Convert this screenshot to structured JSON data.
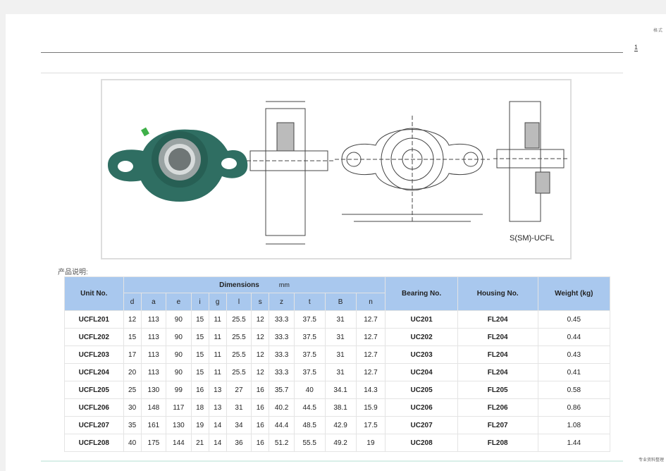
{
  "header": {
    "top_note": "格式",
    "page_number": "1"
  },
  "figure": {
    "label": "S(SM)-UCFL"
  },
  "caption": "产品说明:",
  "table": {
    "col_unit": "Unit No.",
    "dims_title": "Dimensions",
    "dims_unit": "mm",
    "col_bearing": "Bearing No.",
    "col_housing": "Housing No.",
    "col_weight": "Weight (kg)",
    "dim_cols": [
      "d",
      "a",
      "e",
      "i",
      "g",
      "l",
      "s",
      "z",
      "t",
      "B",
      "n"
    ],
    "rows": [
      {
        "unit": "UCFL201",
        "dims": [
          "12",
          "113",
          "90",
          "15",
          "11",
          "25.5",
          "12",
          "33.3",
          "37.5",
          "31",
          "12.7"
        ],
        "bearing": "UC201",
        "housing": "FL204",
        "weight": "0.45"
      },
      {
        "unit": "UCFL202",
        "dims": [
          "15",
          "113",
          "90",
          "15",
          "11",
          "25.5",
          "12",
          "33.3",
          "37.5",
          "31",
          "12.7"
        ],
        "bearing": "UC202",
        "housing": "FL204",
        "weight": "0.44"
      },
      {
        "unit": "UCFL203",
        "dims": [
          "17",
          "113",
          "90",
          "15",
          "11",
          "25.5",
          "12",
          "33.3",
          "37.5",
          "31",
          "12.7"
        ],
        "bearing": "UC203",
        "housing": "FL204",
        "weight": "0.43"
      },
      {
        "unit": "UCFL204",
        "dims": [
          "20",
          "113",
          "90",
          "15",
          "11",
          "25.5",
          "12",
          "33.3",
          "37.5",
          "31",
          "12.7"
        ],
        "bearing": "UC204",
        "housing": "FL204",
        "weight": "0.41"
      },
      {
        "unit": "UCFL205",
        "dims": [
          "25",
          "130",
          "99",
          "16",
          "13",
          "27",
          "16",
          "35.7",
          "40",
          "34.1",
          "14.3"
        ],
        "bearing": "UC205",
        "housing": "FL205",
        "weight": "0.58"
      },
      {
        "unit": "UCFL206",
        "dims": [
          "30",
          "148",
          "117",
          "18",
          "13",
          "31",
          "16",
          "40.2",
          "44.5",
          "38.1",
          "15.9"
        ],
        "bearing": "UC206",
        "housing": "FL206",
        "weight": "0.86"
      },
      {
        "unit": "UCFL207",
        "dims": [
          "35",
          "161",
          "130",
          "19",
          "14",
          "34",
          "16",
          "44.4",
          "48.5",
          "42.9",
          "17.5"
        ],
        "bearing": "UC207",
        "housing": "FL207",
        "weight": "1.08"
      },
      {
        "unit": "UCFL208",
        "dims": [
          "40",
          "175",
          "144",
          "21",
          "14",
          "36",
          "16",
          "51.2",
          "55.5",
          "49.2",
          "19"
        ],
        "bearing": "UC208",
        "housing": "FL208",
        "weight": "1.44"
      }
    ]
  },
  "footer_note": "专业资料整理",
  "colors": {
    "header_blue": "#a9c8ee",
    "housing_green": "#2f6e62"
  }
}
